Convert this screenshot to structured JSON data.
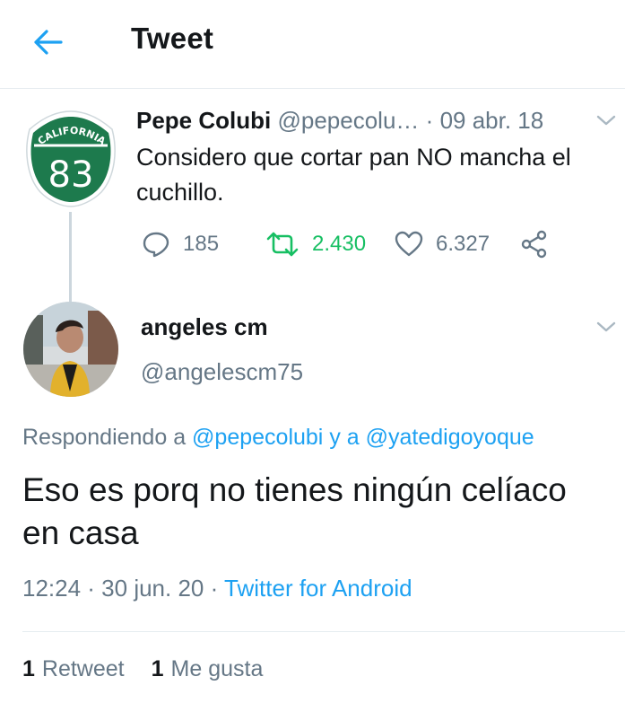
{
  "header": {
    "title": "Tweet"
  },
  "parent_tweet": {
    "name": "Pepe Colubi",
    "handle": "@pepecolu…",
    "separator": "·",
    "date": "09 abr. 18",
    "text": "Considero que cortar pan NO mancha el cuchillo.",
    "replies": "185",
    "retweets": "2.430",
    "likes": "6.327",
    "badge": {
      "top_text": "CALIFORNIA",
      "number": "83"
    }
  },
  "tweet": {
    "name": "angeles cm",
    "handle": "@angelescm75",
    "replying_prefix": "Respondiendo a",
    "replying_user1": "@pepecolubi",
    "replying_conj": "y a",
    "replying_user2": "@yatedigoyoque",
    "text": "Eso es porq no tienes ningún celíaco en casa",
    "time": "12:24 · 30 jun. 20 ·",
    "source": "Twitter for Android",
    "retweet_count": "1",
    "retweet_label": "Retweet",
    "like_count": "1",
    "like_label": "Me gusta"
  },
  "colors": {
    "accent": "#1da1f2",
    "retweet_green": "#17bf63",
    "secondary_text": "#657786",
    "badge_green": "#1d7a4d"
  },
  "icons": [
    "back-arrow-icon",
    "chevron-down-icon",
    "reply-icon",
    "retweet-icon",
    "like-icon",
    "share-icon"
  ]
}
